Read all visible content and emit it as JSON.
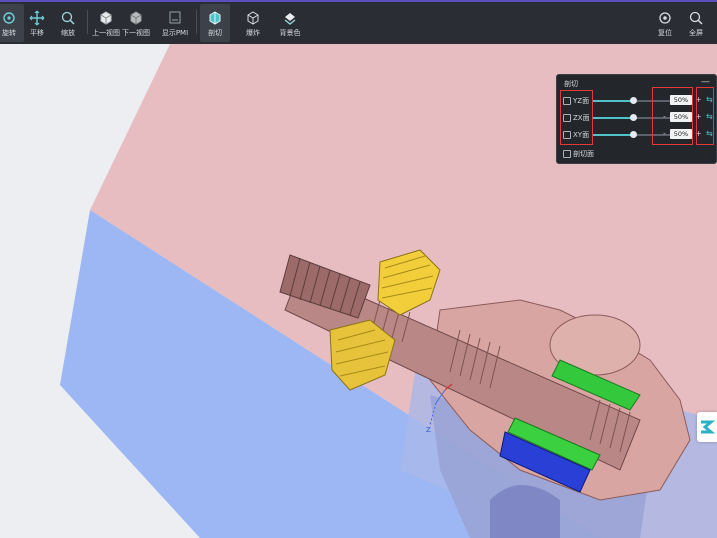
{
  "colors": {
    "toolbar_bg": "#2a2d33",
    "accent": "#4fc3c8",
    "highlight_box": "#e03a3a",
    "section_pink": "#e7b7bd",
    "section_blue": "#98b3f2"
  },
  "toolbar": {
    "left_tools": [
      {
        "label": "旋转",
        "icon": "rotate-icon"
      },
      {
        "label": "平移",
        "icon": "pan-icon"
      },
      {
        "label": "缩放",
        "icon": "zoom-icon"
      },
      {
        "label": "上一视图",
        "icon": "prev-view-icon"
      },
      {
        "label": "下一视图",
        "icon": "next-view-icon"
      },
      {
        "label": "显示PMI",
        "icon": "pmi-icon"
      },
      {
        "label": "剖切",
        "icon": "section-icon"
      },
      {
        "label": "爆炸",
        "icon": "explode-icon"
      },
      {
        "label": "背景色",
        "icon": "background-color-icon"
      }
    ],
    "right_tools": [
      {
        "label": "复位",
        "icon": "reset-icon"
      },
      {
        "label": "全屏",
        "icon": "fullscreen-icon"
      }
    ]
  },
  "section_panel": {
    "title": "剖切",
    "minimize": "—",
    "planes": [
      {
        "label": "YZ面",
        "value": "50%",
        "level": 0.5
      },
      {
        "label": "ZX面",
        "value": "50%",
        "level": 0.5
      },
      {
        "label": "XY面",
        "value": "50%",
        "level": 0.5
      }
    ],
    "minus": "-",
    "plus": "+",
    "swap": "⇆",
    "show_section_label": "剖切面"
  },
  "viewport": {
    "axis_label_z": "Z"
  }
}
